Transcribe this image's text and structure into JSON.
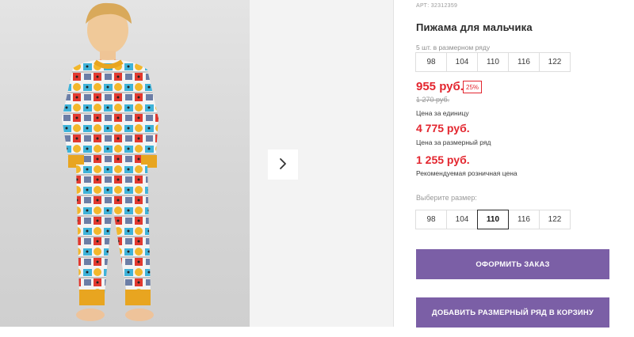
{
  "product": {
    "sku": "АРТ: 32312359",
    "title": "Пижама для мальчика"
  },
  "pack": {
    "note": "5 шт. в размерном ряду",
    "sizes": [
      "98",
      "104",
      "110",
      "116",
      "122"
    ]
  },
  "prices": {
    "unit_price": "955 руб.",
    "discount": "25%",
    "old_price": "1 270 руб.",
    "unit_caption": "Цена за единицу",
    "pack_price": "4 775 руб.",
    "pack_caption": "Цена за размерный ряд",
    "rrp_price": "1 255 руб.",
    "rrp_caption": "Рекомендуемая розничная цена"
  },
  "size_select": {
    "label": "Выберите размер:",
    "options": [
      "98",
      "104",
      "110",
      "116",
      "122"
    ],
    "selected": "110"
  },
  "buttons": {
    "order": "ОФОРМИТЬ ЗАКАЗ",
    "add_to_cart": "ДОБАВИТЬ РАЗМЕРНЫЙ РЯД В КОРЗИНУ"
  },
  "icons": {
    "next": "chevron-right-icon"
  },
  "colors": {
    "accent": "#7b5fa6",
    "price": "#e3262f"
  }
}
